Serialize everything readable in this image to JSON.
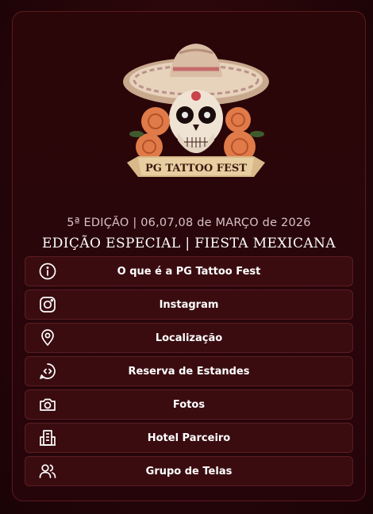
{
  "event": {
    "logo_text": "PG TATTOO FEST",
    "edition_line": "5ª EDIÇÃO | 06,07,08 de MARÇO de 2026",
    "special_line": "EDIÇÃO ESPECIAL | FIESTA MEXICANA"
  },
  "links": [
    {
      "label": "O que é a PG Tattoo Fest",
      "icon": "info-icon"
    },
    {
      "label": "Instagram",
      "icon": "instagram-icon"
    },
    {
      "label": "Localização",
      "icon": "map-pin-icon"
    },
    {
      "label": "Reserva de Estandes",
      "icon": "chat-code-icon"
    },
    {
      "label": "Fotos",
      "icon": "camera-icon"
    },
    {
      "label": "Hotel Parceiro",
      "icon": "building-icon"
    },
    {
      "label": "Grupo de Telas",
      "icon": "users-icon"
    }
  ],
  "colors": {
    "background": "#220508",
    "card": "#2b0609",
    "button": "#3a0c10",
    "border": "#5b1d22"
  }
}
